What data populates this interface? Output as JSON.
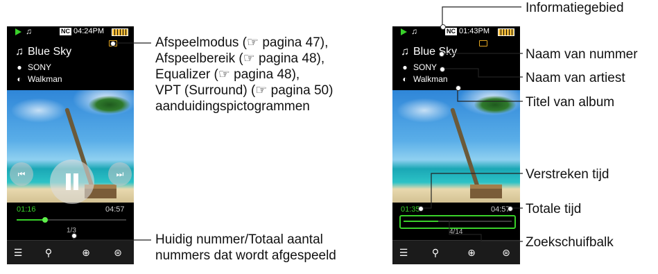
{
  "player": {
    "status_time_left": "04:24PM",
    "status_time_right": "01:43PM",
    "nc_label": "NC",
    "title_left": "Blue Sky",
    "title_right": "Blue Sky",
    "artist": "SONY",
    "album": "Walkman",
    "elapsed_left": "01:16",
    "total_left": "04:57",
    "track_count_left": "1/3",
    "elapsed_right": "01:35",
    "total_right": "04:57",
    "track_count_right": "4/14",
    "progress_left": 0.26,
    "progress_right": 0.32,
    "colors": {
      "accent_green": "#39d12a",
      "battery": "#f0b93a",
      "folder": "#e5a722"
    }
  },
  "icons": {
    "play_indicator": "play-icon",
    "note": "music-note-icon",
    "folder": "folder-icon",
    "artist": "person-icon",
    "album": "disc-icon",
    "prev": "previous-icon",
    "next": "next-icon",
    "pause": "pause-icon",
    "list": "list-icon",
    "search": "search-icon",
    "globe": "globe-icon",
    "options": "options-icon"
  },
  "callouts": {
    "indicators": [
      "Afspeelmodus (☞ pagina 47),",
      "Afspeelbereik (☞ pagina 48),",
      "Equalizer (☞ pagina 48),",
      "VPT (Surround) (☞ pagina 50)",
      "aanduidingspictogrammen"
    ],
    "track_count": [
      "Huidig nummer/Totaal aantal",
      "nummers dat wordt afgespeeld"
    ],
    "info_area": "Informatiegebied",
    "track_name": "Naam van nummer",
    "artist_name": "Naam van artiest",
    "album_title": "Titel van album",
    "elapsed_time": "Verstreken tijd",
    "total_time": "Totale tijd",
    "seek_bar": "Zoekschuifbalk"
  }
}
